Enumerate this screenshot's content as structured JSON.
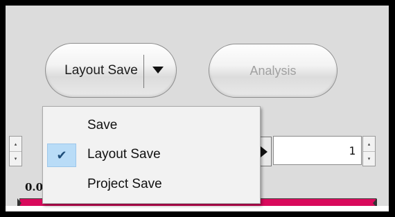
{
  "toolbar": {
    "layout_save_label": "Layout Save",
    "analysis_label": "Analysis"
  },
  "menu": {
    "items": [
      {
        "label": "Save",
        "checked": false
      },
      {
        "label": "Layout Save",
        "checked": true
      },
      {
        "label": "Project Save",
        "checked": false
      }
    ],
    "check_glyph": "✔"
  },
  "controls": {
    "number_value": "1",
    "start_value_partial": "0.0"
  },
  "colors": {
    "track_bar": "#d90a5c",
    "checked_highlight": "#b9dcf7"
  }
}
